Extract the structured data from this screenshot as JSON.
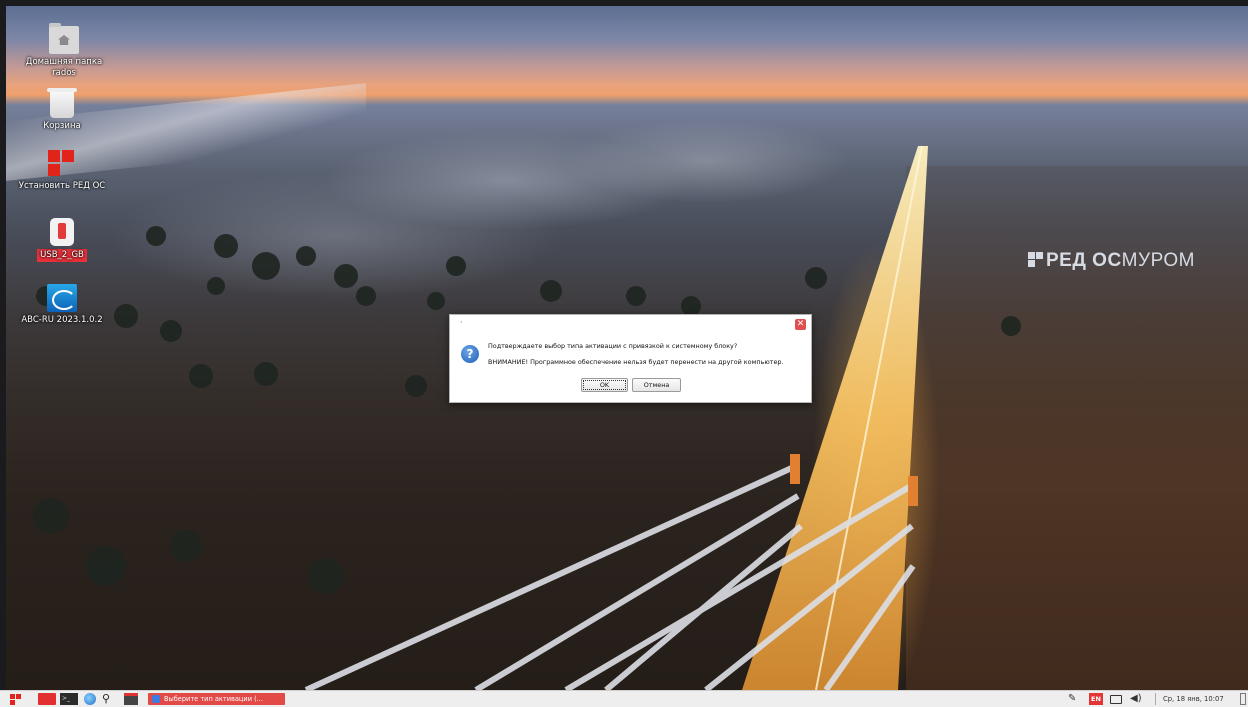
{
  "desktop": {
    "icons": [
      {
        "label_line1": "Домашняя папка",
        "label_line2": "rados",
        "icon": "home-folder-icon"
      },
      {
        "label": "Корзина",
        "icon": "trash-icon"
      },
      {
        "label": "Установить РЕД ОС",
        "icon": "red-os-install-icon"
      },
      {
        "label": "USB_2_GB",
        "icon": "usb-drive-icon"
      },
      {
        "label": "ABC-RU 2023.1.0.2",
        "icon": "abc-ru-app-icon"
      }
    ],
    "wallpaper_logo": {
      "part_bold": "РЕД ОС",
      "part_light": "МУРОМ"
    }
  },
  "dialog": {
    "title": "·",
    "question": "Подтверждаете выбор типа активации с привязкой к системному блоку?",
    "warning": "ВНИМАНИЕ! Программное обеспечение нельзя будет перенести на другой компьютер.",
    "ok_label": "OK",
    "cancel_label": "Отмена",
    "close_glyph": "✕",
    "icon": "question-icon",
    "question_icon_glyph": "?"
  },
  "taskbar": {
    "terminal_glyph": ">_",
    "search_glyph": "⚲",
    "active_task": "Выберите тип активации (...",
    "keyboard_layout": "EN",
    "clock": "Ср, 18 янв, 10:07",
    "tray_glyph": "✎",
    "volume_glyph": "◀)",
    "colors": {
      "accent": "#e24a48",
      "lang_badge": "#e23535"
    }
  }
}
